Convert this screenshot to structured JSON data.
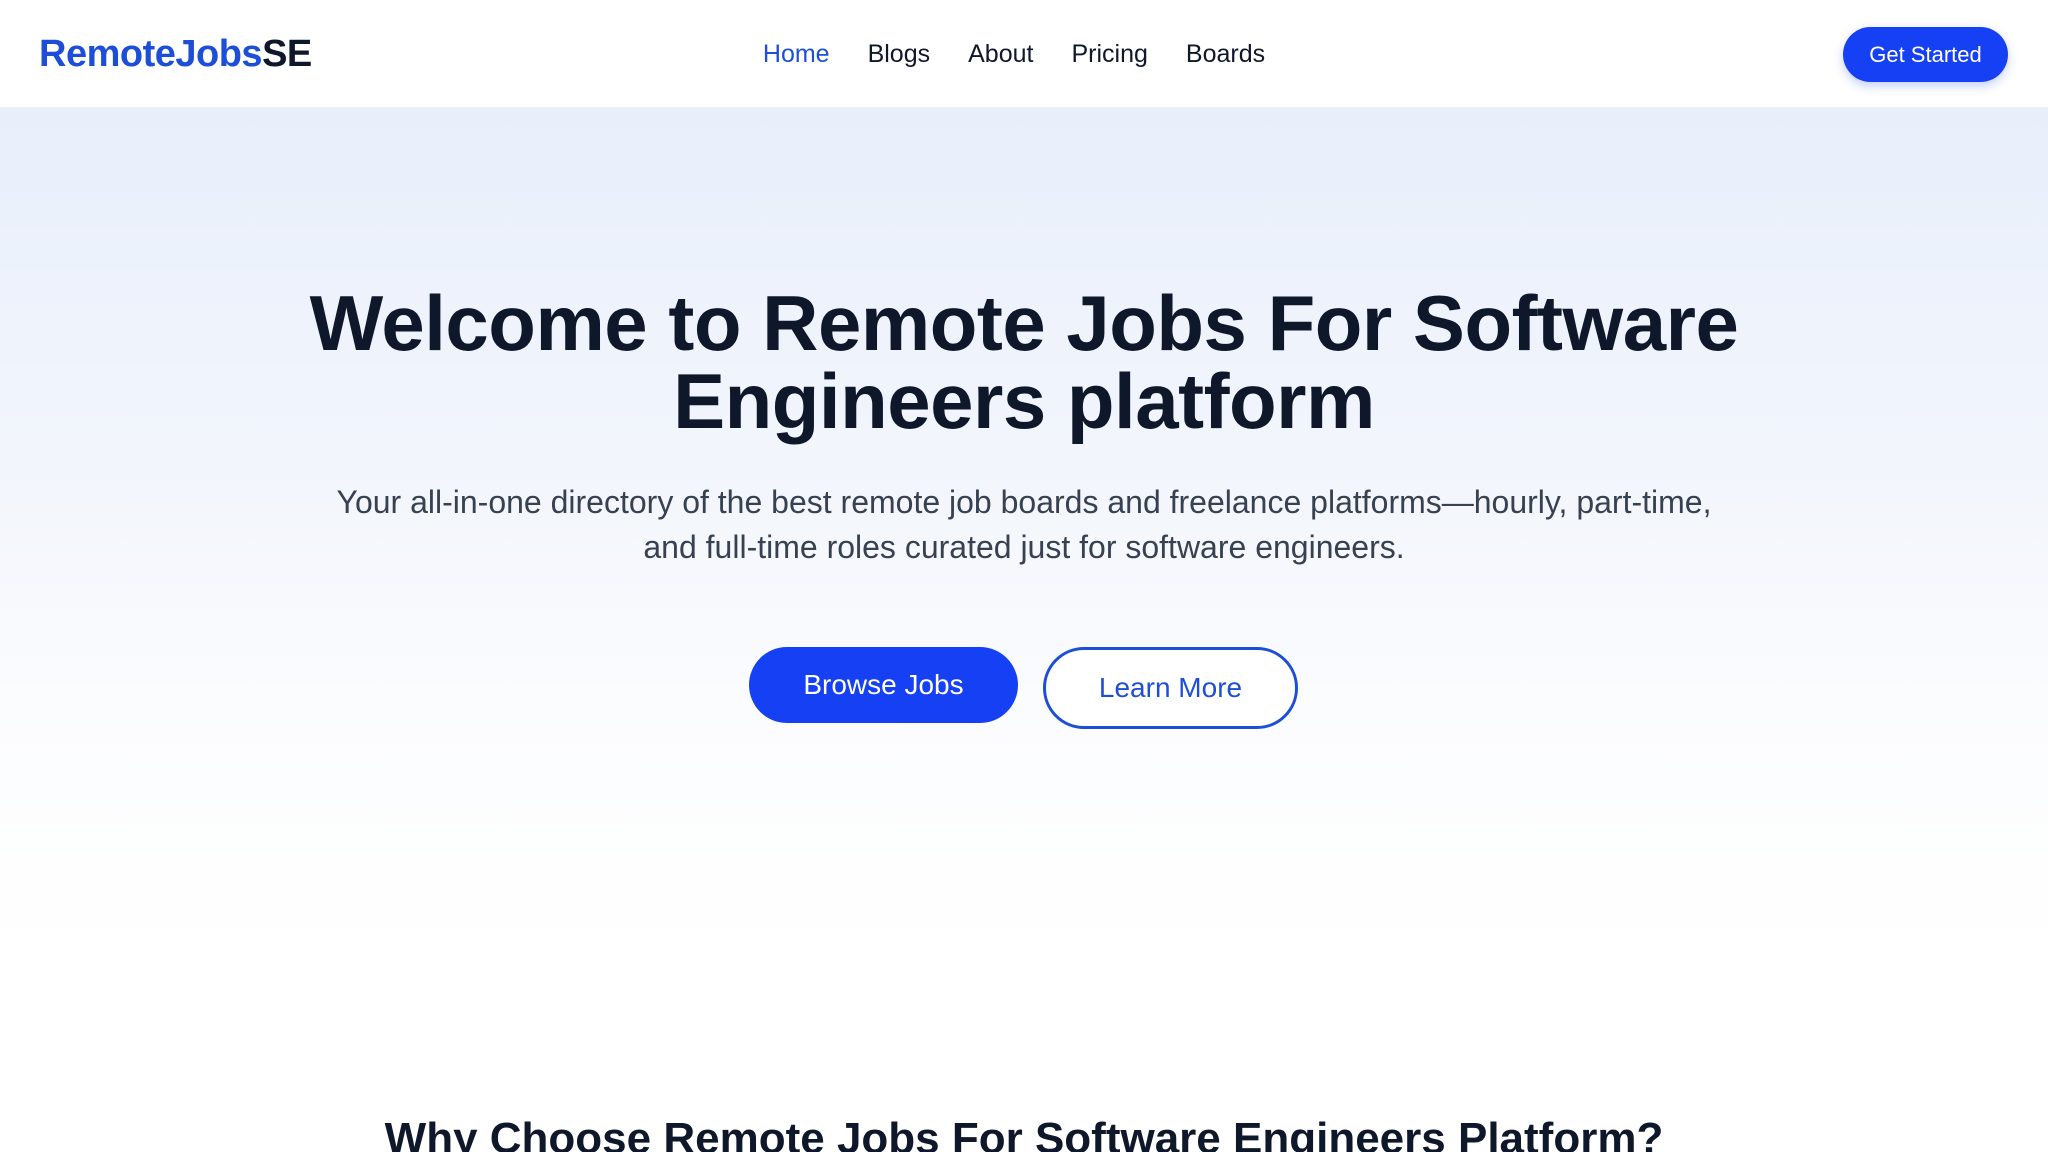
{
  "header": {
    "logo_main": "RemoteJobs",
    "logo_accent": "SE",
    "nav": [
      {
        "label": "Home",
        "active": true
      },
      {
        "label": "Blogs",
        "active": false
      },
      {
        "label": "About",
        "active": false
      },
      {
        "label": "Pricing",
        "active": false
      },
      {
        "label": "Boards",
        "active": false
      }
    ],
    "cta_label": "Get Started"
  },
  "hero": {
    "title_line1": "Welcome to Remote Jobs For Software",
    "title_line2": "Engineers platform",
    "subtitle_line1": "Your all-in-one directory of the best remote job boards and freelance platforms—hourly, part-time,",
    "subtitle_line2": "and full-time roles curated just for software engineers.",
    "primary_button": "Browse Jobs",
    "secondary_button": "Learn More"
  },
  "section": {
    "heading": "Why Choose Remote Jobs For Software Engineers Platform?"
  },
  "colors": {
    "brand_blue": "#1d4ed8",
    "button_blue": "#1640f3",
    "text_dark": "#0f172a",
    "text_muted": "#374151"
  }
}
